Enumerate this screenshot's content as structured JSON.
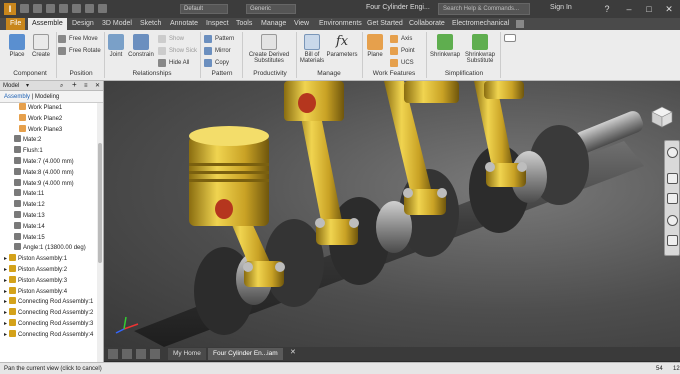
{
  "titlebar": {
    "logo": "I",
    "combo1": "Default",
    "combo2": "Generic",
    "title": "Four Cylinder Engi...",
    "search_placeholder": "Search Help & Commands...",
    "signin": "Sign In",
    "help": "?"
  },
  "tabs": [
    "File",
    "Assemble",
    "Design",
    "3D Model",
    "Sketch",
    "Annotate",
    "Inspect",
    "Tools",
    "Manage",
    "View",
    "Environments",
    "Get Started",
    "Collaborate",
    "Electromechanical"
  ],
  "active_tab": "Assemble",
  "ribbon": {
    "component": {
      "label": "Component",
      "place": "Place",
      "create": "Create"
    },
    "position": {
      "label": "Position",
      "free_move": "Free Move",
      "free_rotate": "Free Rotate"
    },
    "relationships": {
      "label": "Relationships",
      "joint": "Joint",
      "constrain": "Constrain",
      "show": "Show",
      "show_sick": "Show Sick",
      "hide_all": "Hide All"
    },
    "pattern": {
      "label": "Pattern",
      "pattern": "Pattern",
      "mirror": "Mirror",
      "copy": "Copy"
    },
    "productivity": {
      "label": "Productivity",
      "create_derived": "Create Derived",
      "substitutes": "Substitutes"
    },
    "manage": {
      "label": "Manage",
      "bom_line1": "Bill of",
      "bom_line2": "Materials",
      "parameters": "Parameters"
    },
    "work_features": {
      "label": "Work Features",
      "plane": "Plane",
      "axis": "Axis",
      "point": "Point",
      "ucs": "UCS"
    },
    "simplification": {
      "label": "Simplification",
      "shrinkwrap": "Shrinkwrap",
      "shrinkwrap_sub_line1": "Shrinkwrap",
      "shrinkwrap_sub_line2": "Substitute"
    }
  },
  "browser": {
    "header": "Model",
    "tabs": {
      "assembly": "Assembly",
      "sep": "|",
      "modeling": "Modeling"
    },
    "nodes": [
      {
        "label": "Work Plane1",
        "indent": 3,
        "kind": "plane"
      },
      {
        "label": "Work Plane2",
        "indent": 3,
        "kind": "plane"
      },
      {
        "label": "Work Plane3",
        "indent": 3,
        "kind": "plane"
      },
      {
        "label": "Mate:2",
        "indent": 2,
        "kind": "mate"
      },
      {
        "label": "Flush:1",
        "indent": 2,
        "kind": "mate"
      },
      {
        "label": "Mate:7 (4.000 mm)",
        "indent": 2,
        "kind": "mate"
      },
      {
        "label": "Mate:8 (4.000 mm)",
        "indent": 2,
        "kind": "mate"
      },
      {
        "label": "Mate:9 (4.000 mm)",
        "indent": 2,
        "kind": "mate"
      },
      {
        "label": "Mate:11",
        "indent": 2,
        "kind": "mate"
      },
      {
        "label": "Mate:12",
        "indent": 2,
        "kind": "mate"
      },
      {
        "label": "Mate:13",
        "indent": 2,
        "kind": "mate"
      },
      {
        "label": "Mate:14",
        "indent": 2,
        "kind": "mate"
      },
      {
        "label": "Mate:15",
        "indent": 2,
        "kind": "mate"
      },
      {
        "label": "Angle:1 (13800.00 deg)",
        "indent": 2,
        "kind": "angle"
      },
      {
        "label": "Piston Assembly:1",
        "indent": 0,
        "kind": "asm"
      },
      {
        "label": "Piston Assembly:2",
        "indent": 0,
        "kind": "asm"
      },
      {
        "label": "Piston Assembly:3",
        "indent": 0,
        "kind": "asm"
      },
      {
        "label": "Piston Assembly:4",
        "indent": 0,
        "kind": "asm"
      },
      {
        "label": "Connecting Rod Assembly:1",
        "indent": 0,
        "kind": "asm"
      },
      {
        "label": "Connecting Rod Assembly:2",
        "indent": 0,
        "kind": "asm"
      },
      {
        "label": "Connecting Rod Assembly:3",
        "indent": 0,
        "kind": "asm"
      },
      {
        "label": "Connecting Rod Assembly:4",
        "indent": 0,
        "kind": "asm"
      }
    ]
  },
  "doc_tabs": {
    "home": "My Home",
    "doc": "Four Cylinder En...iam"
  },
  "status": {
    "message": "Pan the current view (click to cancel)",
    "n1": "54",
    "n2": "12"
  },
  "colors": {
    "accent": "#c8861c",
    "piston": "#d4b12a",
    "crank": "#3a3a3a",
    "ribbon": "#ececec"
  }
}
